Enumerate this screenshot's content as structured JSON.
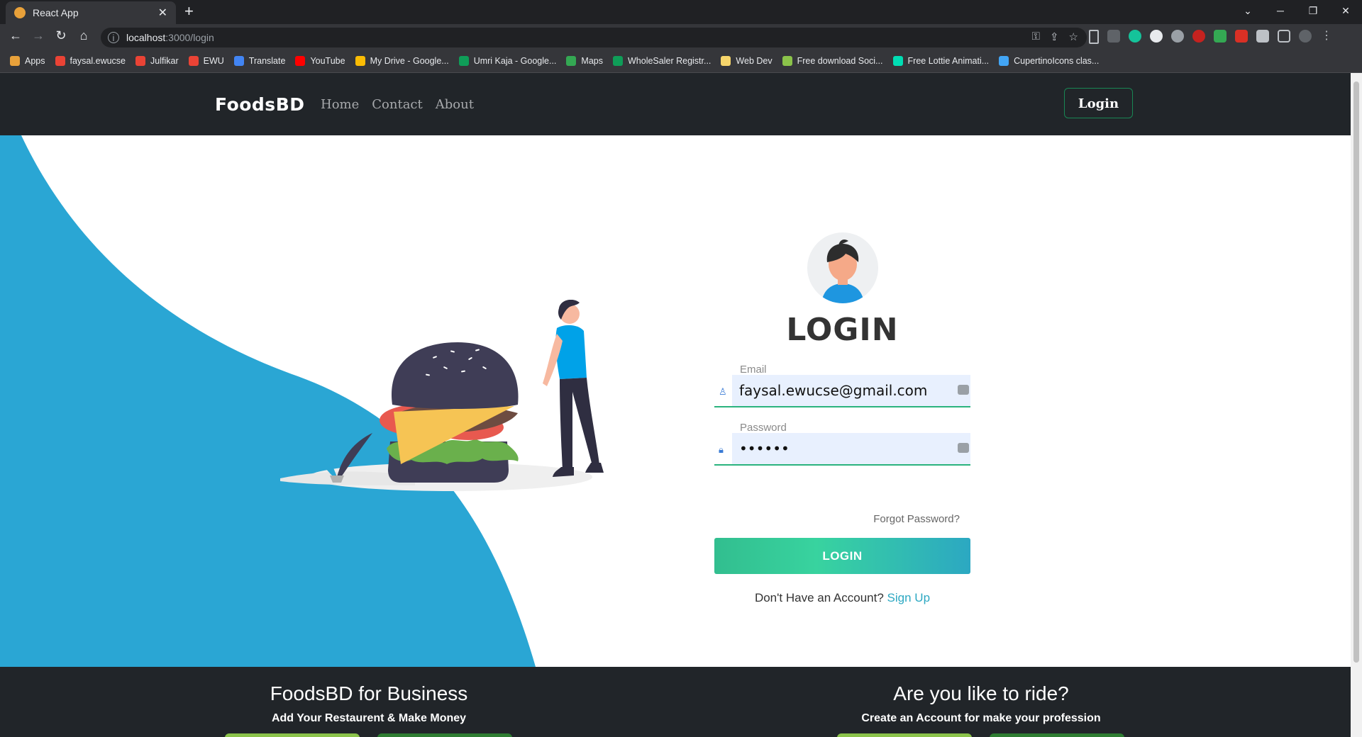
{
  "browser": {
    "tab_title": "React App",
    "tab_close": "✕",
    "new_tab": "+",
    "url_host": "localhost",
    "url_path": ":3000/login",
    "bookmarks": [
      {
        "label": "Apps",
        "icon": "apps-grid-icon",
        "color": "#e8a13a"
      },
      {
        "label": "faysal.ewucse",
        "icon": "gmail-icon",
        "color": "#ea4335"
      },
      {
        "label": "Julfikar",
        "icon": "gmail-icon",
        "color": "#ea4335"
      },
      {
        "label": "EWU",
        "icon": "gmail-icon",
        "color": "#ea4335"
      },
      {
        "label": "Translate",
        "icon": "translate-icon",
        "color": "#4285f4"
      },
      {
        "label": "YouTube",
        "icon": "youtube-icon",
        "color": "#ff0000"
      },
      {
        "label": "My Drive - Google...",
        "icon": "drive-icon",
        "color": "#fbbc04"
      },
      {
        "label": "Umri Kaja - Google...",
        "icon": "sheets-icon",
        "color": "#0f9d58"
      },
      {
        "label": "Maps",
        "icon": "maps-icon",
        "color": "#34a853"
      },
      {
        "label": "WholeSaler Registr...",
        "icon": "sheets-icon",
        "color": "#0f9d58"
      },
      {
        "label": "Web Dev",
        "icon": "folder-icon",
        "color": "#f6d56b"
      },
      {
        "label": "Free download Soci...",
        "icon": "leaf-icon",
        "color": "#8bc34a"
      },
      {
        "label": "Free Lottie Animati...",
        "icon": "lottie-icon",
        "color": "#00ddb3"
      },
      {
        "label": "CupertinoIcons clas...",
        "icon": "flutter-icon",
        "color": "#42a5f5"
      }
    ]
  },
  "navbar": {
    "brand": "FoodsBD",
    "links": [
      "Home",
      "Contact",
      "About"
    ],
    "login": "Login"
  },
  "form": {
    "title": "LOGIN",
    "email_label": "Email",
    "email_value": "faysal.ewucse@gmail.com",
    "password_label": "Password",
    "password_value": "••••••",
    "forgot": "Forgot Password?",
    "submit": "LOGIN",
    "no_account": "Don't Have an Account? ",
    "signup": "Sign Up"
  },
  "footer": {
    "business_title": "FoodsBD for Business",
    "business_sub": "Add Your Restaurent & Make Money",
    "ride_title": "Are you like to ride?",
    "ride_sub": "Create an Account for make your profession"
  },
  "colors": {
    "accent_green": "#38d39f",
    "accent_blue": "#2ca8c2",
    "hero_blue": "#2aa6d4",
    "navbar": "#212529"
  }
}
